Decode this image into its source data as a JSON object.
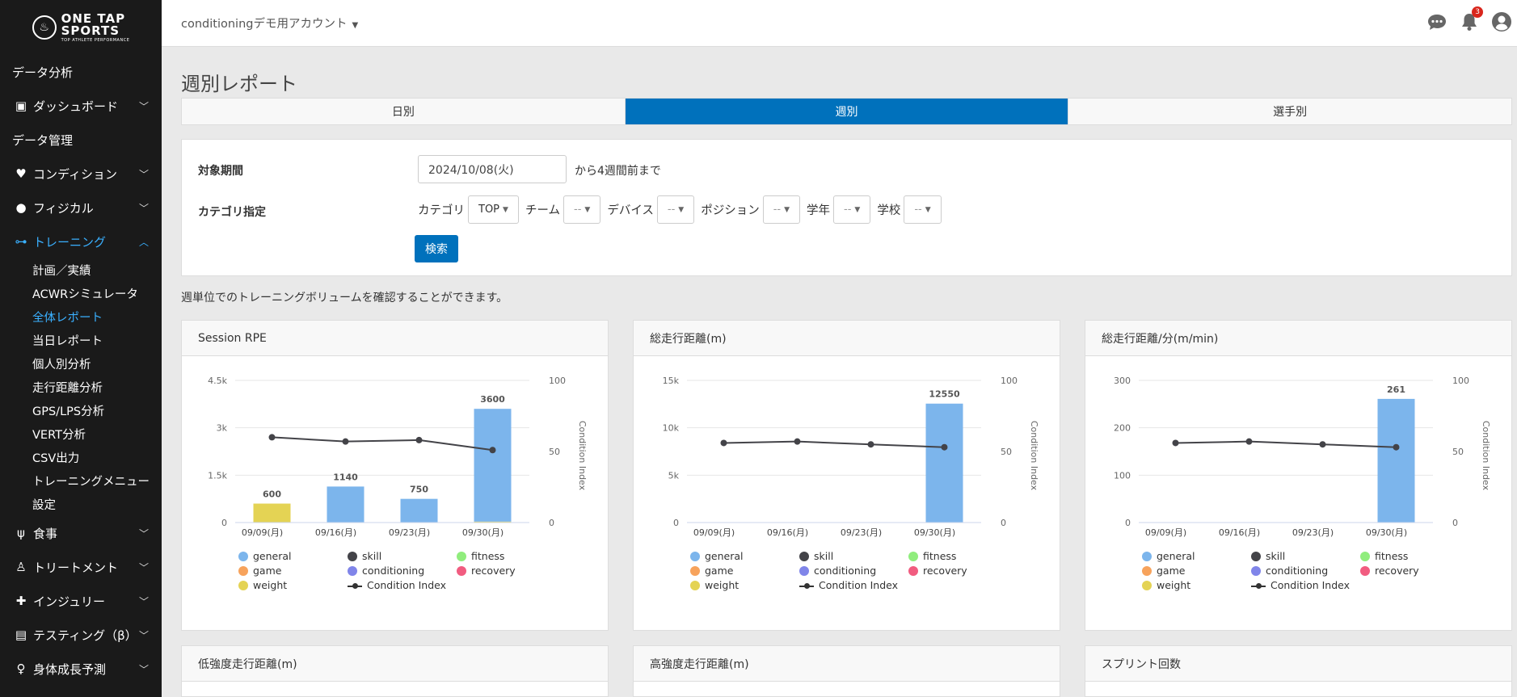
{
  "brand": {
    "line1": "ONE TAP",
    "line2": "SPORTS",
    "tagline": "TOP ATHLETE PERFORMANCE"
  },
  "account": {
    "name": "conditioningデモ用アカウント"
  },
  "notifications": {
    "count": "3"
  },
  "sidebar": {
    "items": [
      {
        "label": "データ分析",
        "icon": "",
        "chevron": ""
      },
      {
        "label": "ダッシュボード",
        "icon": "id-card-icon",
        "chevron": "down"
      },
      {
        "label": "データ管理",
        "icon": "",
        "chevron": ""
      },
      {
        "label": "コンディション",
        "icon": "heartbeat-icon",
        "chevron": "down"
      },
      {
        "label": "フィジカル",
        "icon": "user-circle-icon",
        "chevron": "down"
      },
      {
        "label": "トレーニング",
        "icon": "dumbbell-icon",
        "chevron": "up",
        "active": true
      }
    ],
    "training_sub": [
      "計画／実績",
      "ACWRシミュレータ",
      "全体レポート",
      "当日レポート",
      "個人別分析",
      "走行距離分析",
      "GPS/LPS分析",
      "VERT分析",
      "CSV出力",
      "トレーニングメニュー",
      "設定"
    ],
    "training_sub_active": "全体レポート",
    "bottom_items": [
      {
        "label": "食事",
        "icon": "utensils-icon"
      },
      {
        "label": "トリートメント",
        "icon": "user-doctor-icon"
      },
      {
        "label": "インジュリー",
        "icon": "first-aid-icon"
      },
      {
        "label": "テスティング（β）",
        "icon": "chart-icon"
      },
      {
        "label": "身体成長予測",
        "icon": "child-icon"
      }
    ]
  },
  "page": {
    "title": "週別レポート",
    "tabs": [
      "日別",
      "週別",
      "選手別"
    ],
    "active_tab": "週別",
    "filter": {
      "period_label": "対象期間",
      "date_value": "2024/10/08(火)",
      "date_suffix": "から4週間前まで",
      "category_label": "カテゴリ指定",
      "fields": [
        {
          "label": "カテゴリ",
          "value": "TOP"
        },
        {
          "label": "チーム",
          "value": "--"
        },
        {
          "label": "デバイス",
          "value": "--"
        },
        {
          "label": "ポジション",
          "value": "--"
        },
        {
          "label": "学年",
          "value": "--"
        },
        {
          "label": "学校",
          "value": "--"
        }
      ],
      "search_label": "検索"
    },
    "description": "週単位でのトレーニングボリュームを確認することができます。",
    "legend": {
      "general": "general",
      "skill": "skill",
      "fitness": "fitness",
      "game": "game",
      "conditioning": "conditioning",
      "recovery": "recovery",
      "weight": "weight",
      "condition_index": "Condition Index"
    },
    "legend_colors": {
      "general": "#7cb5ec",
      "skill": "#434348",
      "fitness": "#90ed7d",
      "game": "#f7a35c",
      "conditioning": "#8085e9",
      "recovery": "#f15c80",
      "weight": "#e4d354"
    },
    "bottom_cards": [
      "低強度走行距離(m)",
      "高強度走行距離(m)",
      "スプリント回数"
    ]
  },
  "chart_data": [
    {
      "type": "bar",
      "title": "Session RPE",
      "categories": [
        "09/09(月)",
        "09/16(月)",
        "09/23(月)",
        "09/30(月)"
      ],
      "series": [
        {
          "name": "weight",
          "values": [
            600,
            0,
            0,
            30
          ]
        },
        {
          "name": "general",
          "values": [
            0,
            1140,
            750,
            3570
          ]
        },
        {
          "name": "Condition Index",
          "type": "line",
          "values": [
            60,
            57,
            58,
            51
          ]
        }
      ],
      "data_labels": [
        "600",
        "1140",
        "750",
        "3600"
      ],
      "y_ticks": [
        "0",
        "1.5k",
        "3k",
        "4.5k"
      ],
      "ylim": [
        0,
        4500
      ],
      "y2_ticks": [
        "0",
        "50",
        "100"
      ],
      "y2lim": [
        0,
        100
      ],
      "y2label": "Condition Index"
    },
    {
      "type": "bar",
      "title": "総走行距離(m)",
      "categories": [
        "09/09(月)",
        "09/16(月)",
        "09/23(月)",
        "09/30(月)"
      ],
      "series": [
        {
          "name": "general",
          "values": [
            0,
            0,
            0,
            12550
          ]
        },
        {
          "name": "Condition Index",
          "type": "line",
          "values": [
            56,
            57,
            55,
            53
          ]
        }
      ],
      "data_labels": [
        "",
        "",
        "",
        "12550"
      ],
      "y_ticks": [
        "0",
        "5k",
        "10k",
        "15k"
      ],
      "ylim": [
        0,
        15000
      ],
      "y2_ticks": [
        "0",
        "50",
        "100"
      ],
      "y2lim": [
        0,
        100
      ],
      "y2label": "Condition Index"
    },
    {
      "type": "bar",
      "title": "総走行距離/分(m/min)",
      "categories": [
        "09/09(月)",
        "09/16(月)",
        "09/23(月)",
        "09/30(月)"
      ],
      "series": [
        {
          "name": "general",
          "values": [
            0,
            0,
            0,
            261
          ]
        },
        {
          "name": "Condition Index",
          "type": "line",
          "values": [
            56,
            57,
            55,
            53
          ]
        }
      ],
      "data_labels": [
        "",
        "",
        "",
        "261"
      ],
      "y_ticks": [
        "0",
        "100",
        "200",
        "300"
      ],
      "ylim": [
        0,
        300
      ],
      "y2_ticks": [
        "0",
        "50",
        "100"
      ],
      "y2lim": [
        0,
        100
      ],
      "y2label": "Condition Index"
    }
  ]
}
